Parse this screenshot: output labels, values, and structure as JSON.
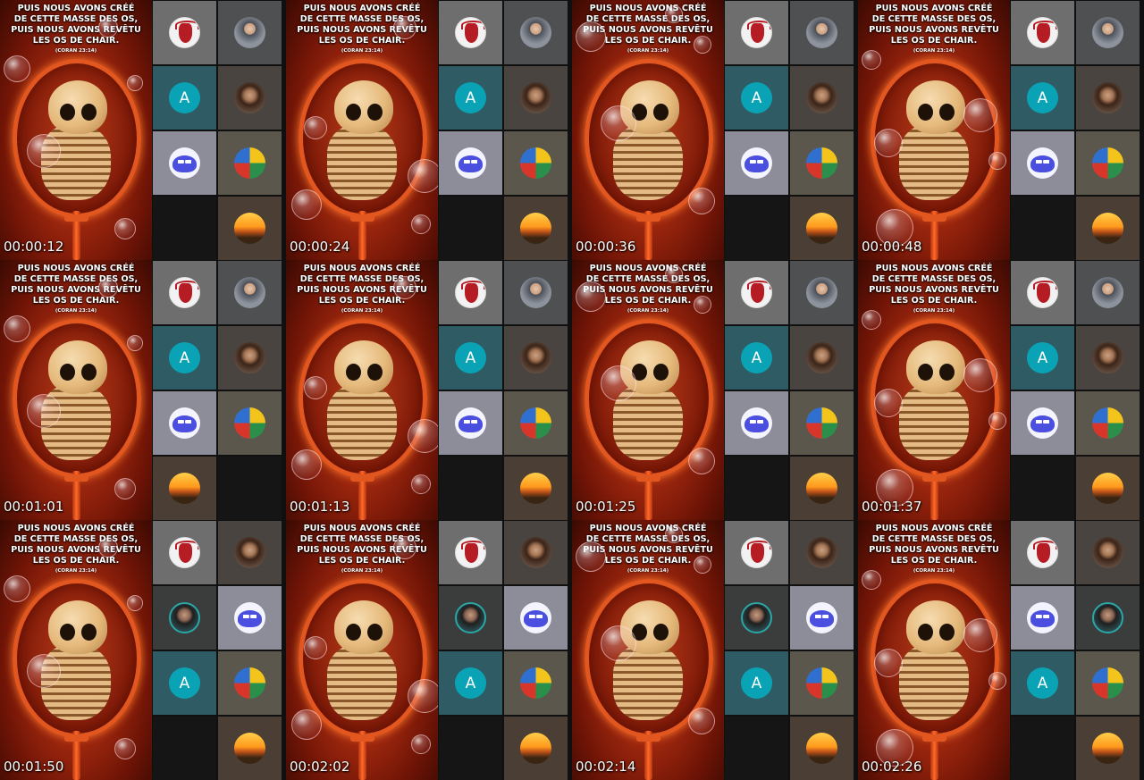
{
  "caption_lines": [
    "PUIS NOUS AVONS CRÉÉ",
    "DE CETTE MASSE DES OS,",
    "PUIS NOUS AVONS REVÊTU",
    "LES OS DE CHAIR."
  ],
  "caption_ref": "(CORAN 23:14)",
  "participant_letter": "A",
  "frames": [
    {
      "time": "00:00:12",
      "tiles": [
        "devil",
        "man",
        "letter",
        "woman",
        "blob",
        "cartoon",
        "empty",
        "sunset"
      ]
    },
    {
      "time": "00:00:24",
      "tiles": [
        "devil",
        "man",
        "letter",
        "woman",
        "blob",
        "cartoon",
        "empty",
        "sunset"
      ]
    },
    {
      "time": "00:00:36",
      "tiles": [
        "devil",
        "man",
        "letter",
        "woman",
        "blob",
        "cartoon",
        "empty",
        "sunset"
      ]
    },
    {
      "time": "00:00:48",
      "tiles": [
        "devil",
        "man",
        "letter",
        "woman",
        "blob",
        "cartoon",
        "empty",
        "sunset"
      ]
    },
    {
      "time": "00:01:01",
      "tiles": [
        "devil",
        "man",
        "letter",
        "woman",
        "blob",
        "cartoon",
        "sunset",
        "empty"
      ]
    },
    {
      "time": "00:01:13",
      "tiles": [
        "devil",
        "man",
        "letter",
        "woman",
        "blob",
        "cartoon",
        "empty",
        "sunset"
      ]
    },
    {
      "time": "00:01:25",
      "tiles": [
        "devil",
        "man",
        "letter",
        "woman",
        "blob",
        "cartoon",
        "empty",
        "sunset"
      ]
    },
    {
      "time": "00:01:37",
      "tiles": [
        "devil",
        "man",
        "letter",
        "woman",
        "blob",
        "cartoon",
        "empty",
        "sunset"
      ]
    },
    {
      "time": "00:01:50",
      "tiles": [
        "devil",
        "woman",
        "beard",
        "blob",
        "letter",
        "cartoon",
        "empty",
        "sunset"
      ]
    },
    {
      "time": "00:02:02",
      "tiles": [
        "devil",
        "woman",
        "beard",
        "blob",
        "letter",
        "cartoon",
        "empty",
        "sunset"
      ]
    },
    {
      "time": "00:02:14",
      "tiles": [
        "devil",
        "woman",
        "beard",
        "blob",
        "letter",
        "cartoon",
        "empty",
        "sunset"
      ]
    },
    {
      "time": "00:02:26",
      "tiles": [
        "devil",
        "woman",
        "blob",
        "beard",
        "letter",
        "cartoon",
        "empty",
        "sunset"
      ]
    }
  ]
}
